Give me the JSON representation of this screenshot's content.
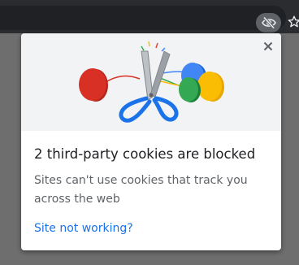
{
  "toolbar": {
    "cookie_icon": "eye-crossed-icon",
    "bookmark_icon": "star-outline-icon"
  },
  "popup": {
    "close_icon": "close-icon",
    "illustration_icon": "scissors-cutting-cookies-illustration",
    "title": "2 third-party cookies are blocked",
    "description": "Sites can't use cookies that track you across the web",
    "link": "Site not working?"
  },
  "colors": {
    "page_overlay": "#6e6e6e",
    "toolbar": "#2b2c2f",
    "link": "#1a73e8",
    "cookie_red": "#d93025",
    "cookie_blue": "#4285f4",
    "cookie_green": "#34a853",
    "cookie_yellow": "#fbbc04"
  }
}
